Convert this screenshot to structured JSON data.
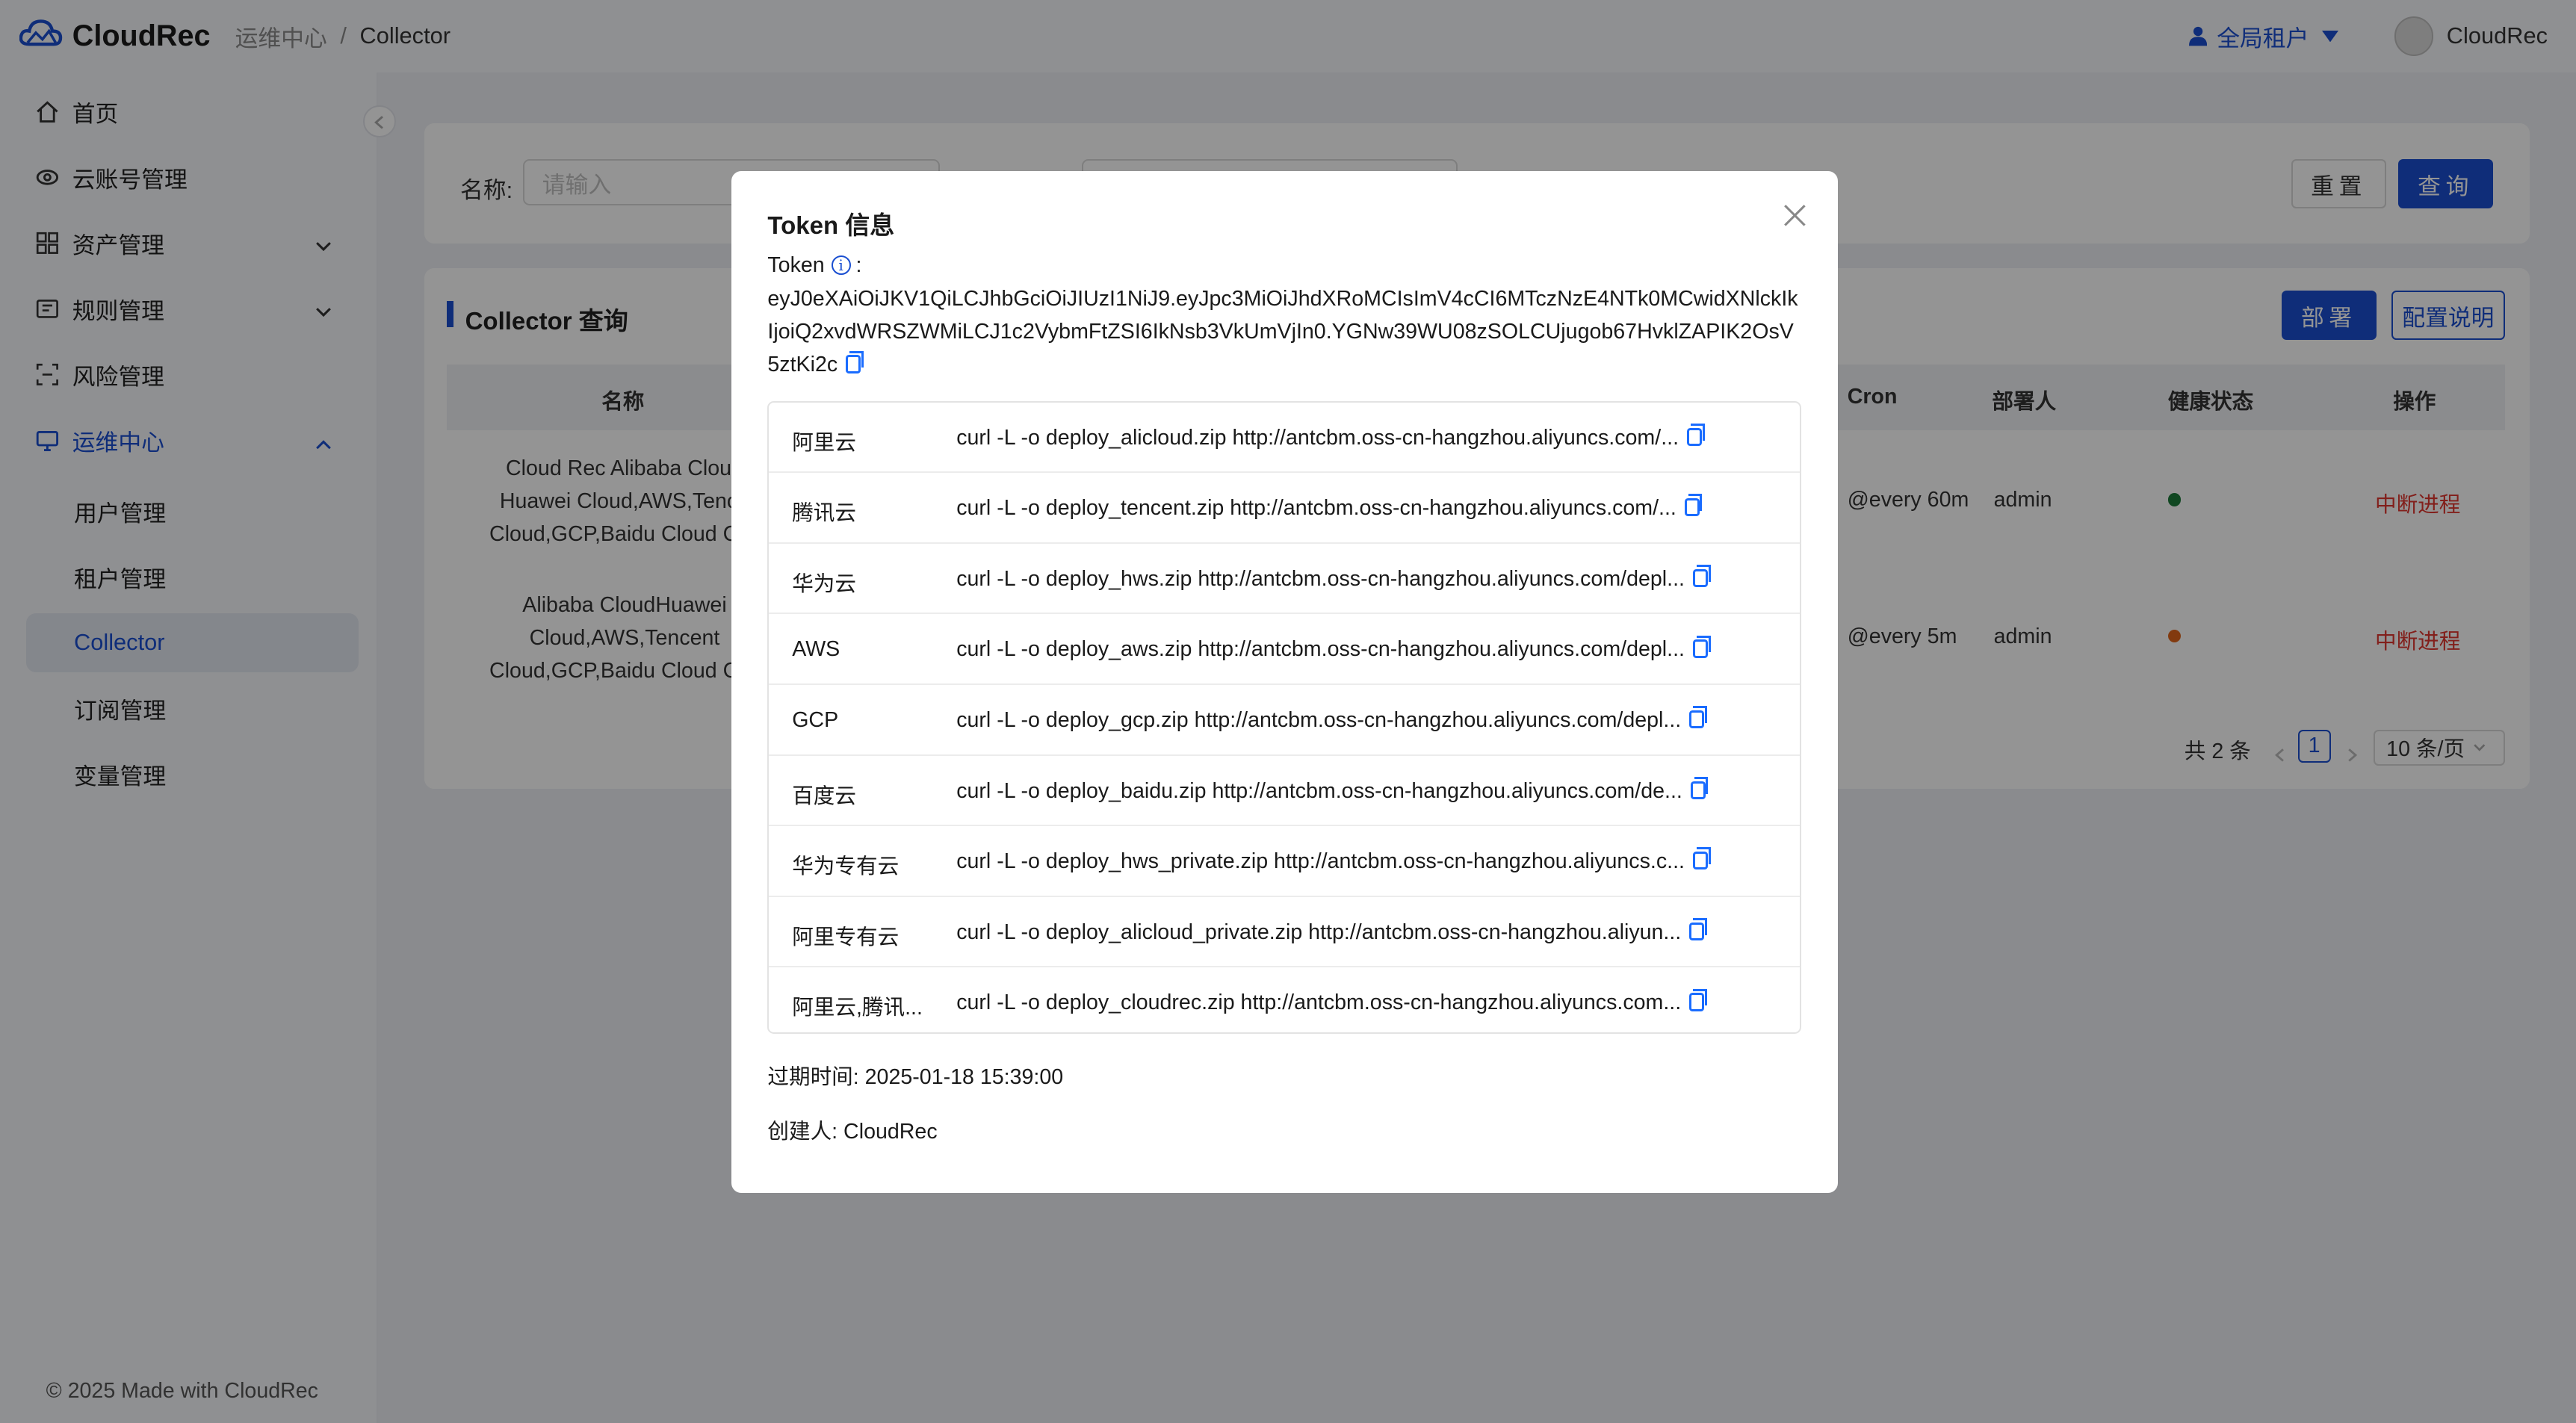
{
  "header": {
    "app_name": "CloudRec",
    "breadcrumb": [
      "运维中心",
      "Collector"
    ],
    "breadcrumb_sep": "/",
    "tenant": "全局租户",
    "user": "CloudRec"
  },
  "sidebar": {
    "items": [
      {
        "label": "首页",
        "icon": "home-icon"
      },
      {
        "label": "云账号管理",
        "icon": "cloud-account-icon"
      },
      {
        "label": "资产管理",
        "icon": "asset-icon"
      },
      {
        "label": "规则管理",
        "icon": "rule-icon"
      },
      {
        "label": "风险管理",
        "icon": "risk-icon"
      },
      {
        "label": "运维中心",
        "icon": "ops-icon"
      }
    ],
    "sub_items": [
      "用户管理",
      "租户管理",
      "Collector",
      "订阅管理",
      "变量管理"
    ],
    "active_sub": "Collector",
    "footer": "© 2025 Made with CloudRec"
  },
  "search": {
    "name_label": "名称:",
    "name_placeholder": "请输入",
    "reset": "重置",
    "query": "查询"
  },
  "table": {
    "title": "Collector 查询",
    "deploy_btn": "部署",
    "config_btn": "配置说明",
    "columns": {
      "name": "名称",
      "cron": "Cron",
      "deployer": "部署人",
      "health": "健康状态",
      "action": "操作"
    },
    "rows": [
      {
        "name_lines": [
          "Cloud Rec Alibaba Cloud",
          "Huawei Cloud,AWS,Tence",
          "Cloud,GCP,Baidu Cloud Coll"
        ],
        "cron": "@every 60m",
        "deployer": "admin",
        "health_color": "#1d7a3a",
        "action": "中断进程"
      },
      {
        "name_lines": [
          "Alibaba CloudHuawei",
          "Cloud,AWS,Tencent",
          "Cloud,GCP,Baidu Cloud Coll"
        ],
        "cron": "@every 5m",
        "deployer": "admin",
        "health_color": "#e0641b",
        "action": "中断进程"
      }
    ],
    "total": "共 2 条",
    "page": "1",
    "page_size": "10 条/页"
  },
  "modal": {
    "title": "Token 信息",
    "token_label": "Token",
    "token_colon": ":",
    "token": "eyJ0eXAiOiJKV1QiLCJhbGciOiJIUzI1NiJ9.eyJpc3MiOiJhdXRoMCIsImV4cCI6MTczNzE4NTk0MCwidXNlckIkIjoiQ2xvdWRSZWMiLCJ1c2VybmFtZSI6IkNsb3VkUmVjIn0.YGNw39WU08zSOLCUjugob67HvklZAPIK2OsV5ztKi2c",
    "deploy_list": [
      {
        "name": "阿里云",
        "cmd": "curl -L -o deploy_alicloud.zip http://antcbm.oss-cn-hangzhou.aliyuncs.com/..."
      },
      {
        "name": "腾讯云",
        "cmd": "curl -L -o deploy_tencent.zip http://antcbm.oss-cn-hangzhou.aliyuncs.com/..."
      },
      {
        "name": "华为云",
        "cmd": "curl -L -o deploy_hws.zip http://antcbm.oss-cn-hangzhou.aliyuncs.com/depl..."
      },
      {
        "name": "AWS",
        "cmd": "curl -L -o deploy_aws.zip http://antcbm.oss-cn-hangzhou.aliyuncs.com/depl..."
      },
      {
        "name": "GCP",
        "cmd": "curl -L -o deploy_gcp.zip http://antcbm.oss-cn-hangzhou.aliyuncs.com/depl..."
      },
      {
        "name": "百度云",
        "cmd": "curl -L -o deploy_baidu.zip http://antcbm.oss-cn-hangzhou.aliyuncs.com/de..."
      },
      {
        "name": "华为专有云",
        "cmd": "curl -L -o deploy_hws_private.zip http://antcbm.oss-cn-hangzhou.aliyuncs.c..."
      },
      {
        "name": "阿里专有云",
        "cmd": "curl -L -o deploy_alicloud_private.zip http://antcbm.oss-cn-hangzhou.aliyun..."
      },
      {
        "name": "阿里云,腾讯...",
        "cmd": "curl -L -o deploy_cloudrec.zip http://antcbm.oss-cn-hangzhou.aliyuncs.com..."
      }
    ],
    "expire": "过期时间: 2025-01-18 15:39:00",
    "creator": "创建人: CloudRec"
  },
  "colors": {
    "primary": "#1a4fd1",
    "danger": "#e0362f",
    "overlay": "rgba(0,0,0,0.42)"
  }
}
